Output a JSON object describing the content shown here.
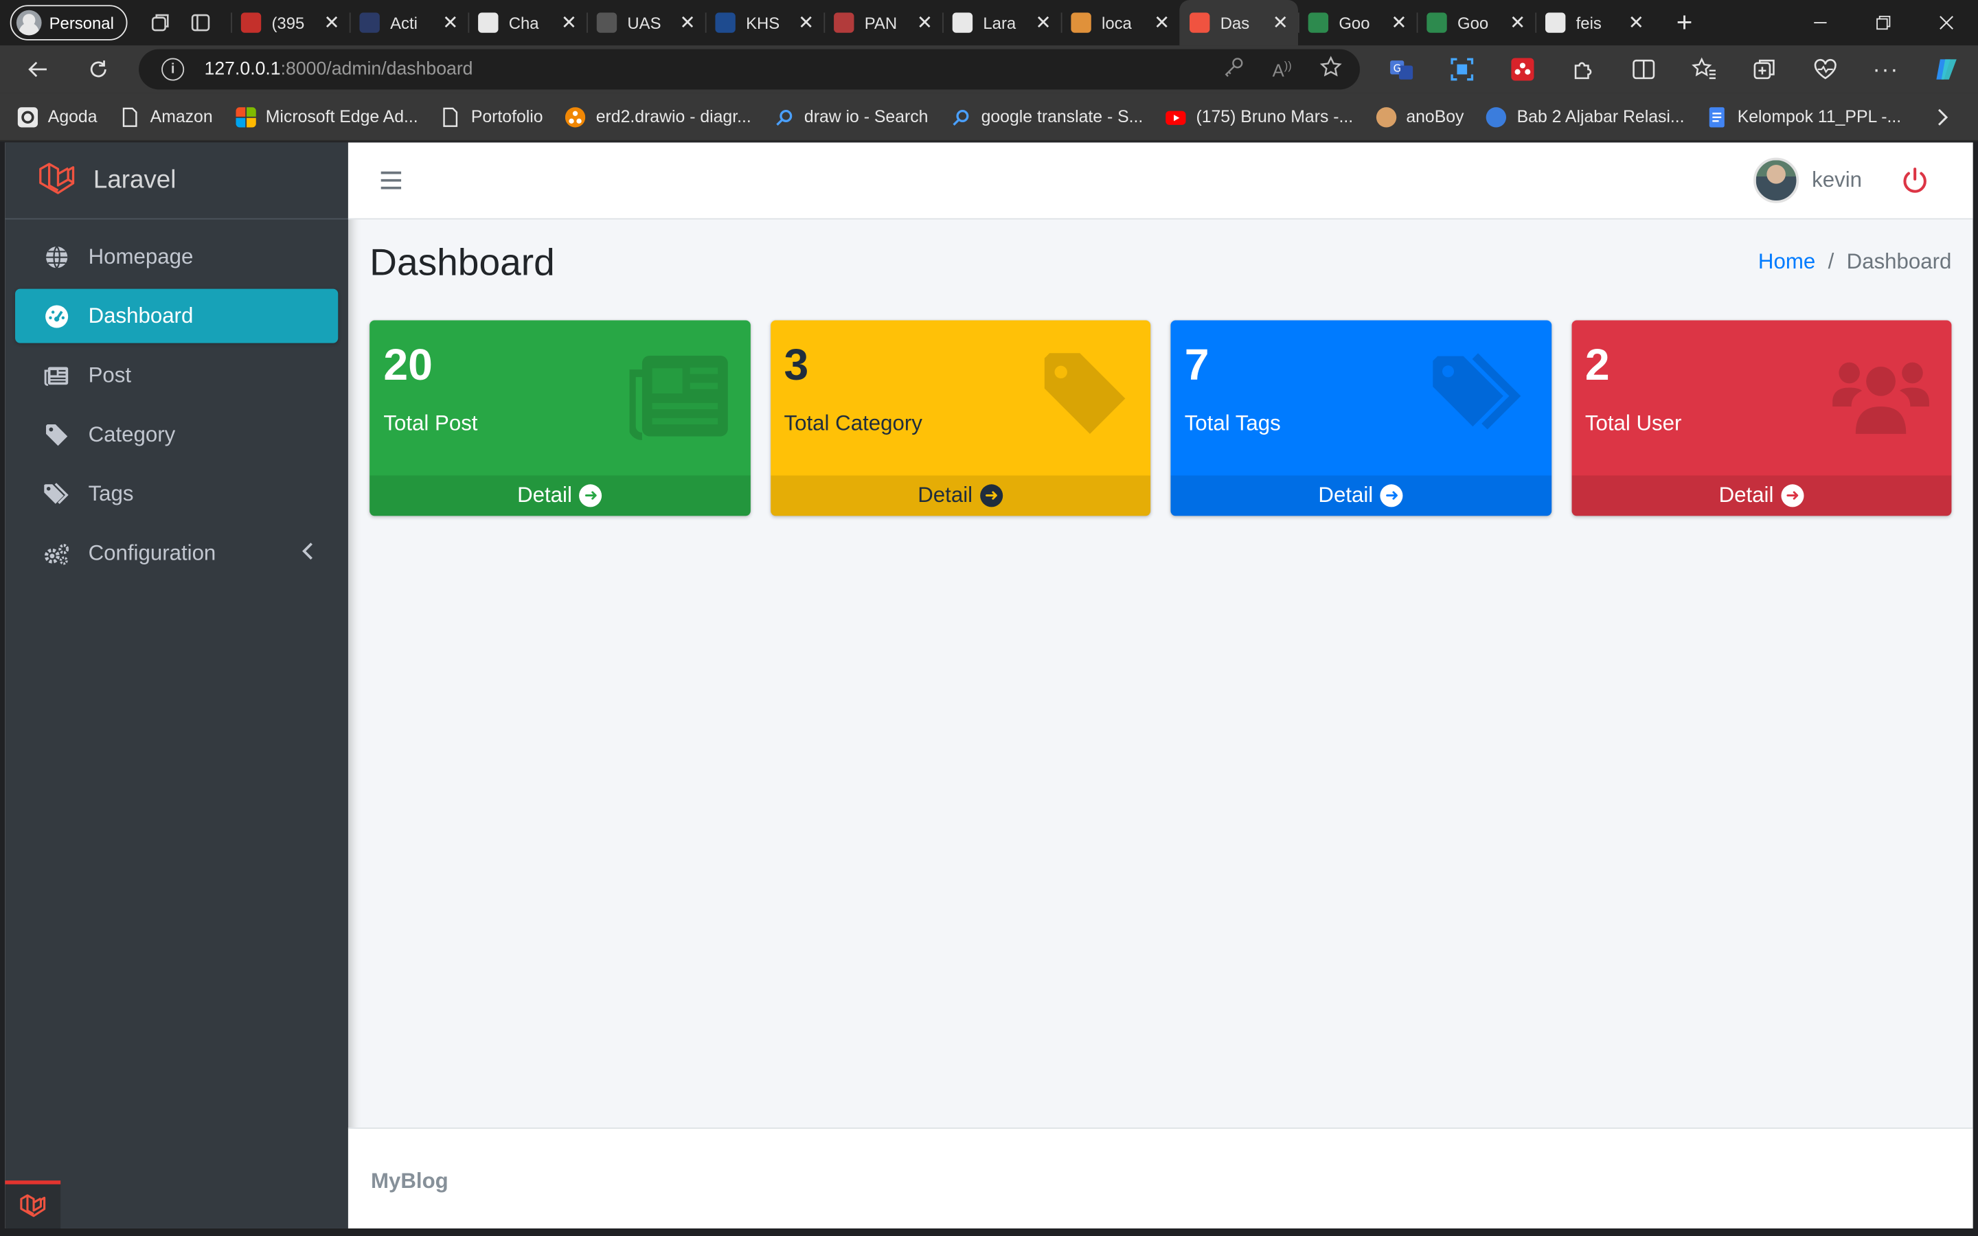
{
  "browser": {
    "profile_label": "Personal",
    "tabs": [
      {
        "title": "(395",
        "color": "#c4302b"
      },
      {
        "title": "Acti",
        "color": "#2b3a67"
      },
      {
        "title": "Cha",
        "color": "#e8e8e8"
      },
      {
        "title": "UAS",
        "color": "#555555"
      },
      {
        "title": "KHS",
        "color": "#1e4b8f"
      },
      {
        "title": "PAN",
        "color": "#b23b3b"
      },
      {
        "title": "Lara",
        "color": "#e8e8e8"
      },
      {
        "title": "loca",
        "color": "#e0913a"
      },
      {
        "title": "Das",
        "color": "#f05340"
      },
      {
        "title": "Goo",
        "color": "#2d8a4e"
      },
      {
        "title": "Goo",
        "color": "#2d8a4e"
      },
      {
        "title": "feis",
        "color": "#e8e8e8"
      }
    ],
    "active_tab_index": 8,
    "url_host": "127.0.0.1",
    "url_rest": ":8000/admin/dashboard",
    "bookmarks": [
      {
        "label": "Agoda",
        "icon": "agoda-icon",
        "color": "#e8e8e8"
      },
      {
        "label": "Amazon",
        "icon": "page-icon",
        "color": "#e8e8e8"
      },
      {
        "label": "Microsoft Edge Ad...",
        "icon": "microsoft-icon",
        "color": "#f25022"
      },
      {
        "label": "Portofolio",
        "icon": "page-icon",
        "color": "#e8e8e8"
      },
      {
        "label": "erd2.drawio - diagr...",
        "icon": "drawio-icon",
        "color": "#f08705"
      },
      {
        "label": "draw io - Search",
        "icon": "search-icon",
        "color": "#4aa0ff"
      },
      {
        "label": "google translate - S...",
        "icon": "search-icon",
        "color": "#4aa0ff"
      },
      {
        "label": "(175) Bruno Mars -...",
        "icon": "youtube-icon",
        "color": "#ff0000"
      },
      {
        "label": "anoBoy",
        "icon": "anoboy-icon",
        "color": "#d9a066"
      },
      {
        "label": "Bab 2 Aljabar Relasi...",
        "icon": "doc-icon",
        "color": "#3b7ddd"
      },
      {
        "label": "Kelompok 11_PPL -...",
        "icon": "docs-icon",
        "color": "#4285f4"
      }
    ]
  },
  "app": {
    "brand": "Laravel",
    "nav": [
      {
        "label": "Homepage",
        "icon": "globe-icon"
      },
      {
        "label": "Dashboard",
        "icon": "tachometer-icon"
      },
      {
        "label": "Post",
        "icon": "newspaper-icon"
      },
      {
        "label": "Category",
        "icon": "tag-icon"
      },
      {
        "label": "Tags",
        "icon": "tags-icon"
      },
      {
        "label": "Configuration",
        "icon": "cogs-icon"
      }
    ],
    "active_nav_index": 1,
    "user_name": "kevin",
    "page_title": "Dashboard",
    "breadcrumb": {
      "home": "Home",
      "separator": "/",
      "current": "Dashboard"
    },
    "stats": [
      {
        "value": "20",
        "label": "Total Post",
        "link": "Detail",
        "color": "#28a745",
        "icon": "newspaper-icon"
      },
      {
        "value": "3",
        "label": "Total Category",
        "link": "Detail",
        "color": "#ffc107",
        "icon": "tag-icon"
      },
      {
        "value": "7",
        "label": "Total Tags",
        "link": "Detail",
        "color": "#007bff",
        "icon": "tags-icon"
      },
      {
        "value": "2",
        "label": "Total User",
        "link": "Detail",
        "color": "#dc3545",
        "icon": "users-icon"
      }
    ],
    "footer_brand": "MyBlog"
  }
}
